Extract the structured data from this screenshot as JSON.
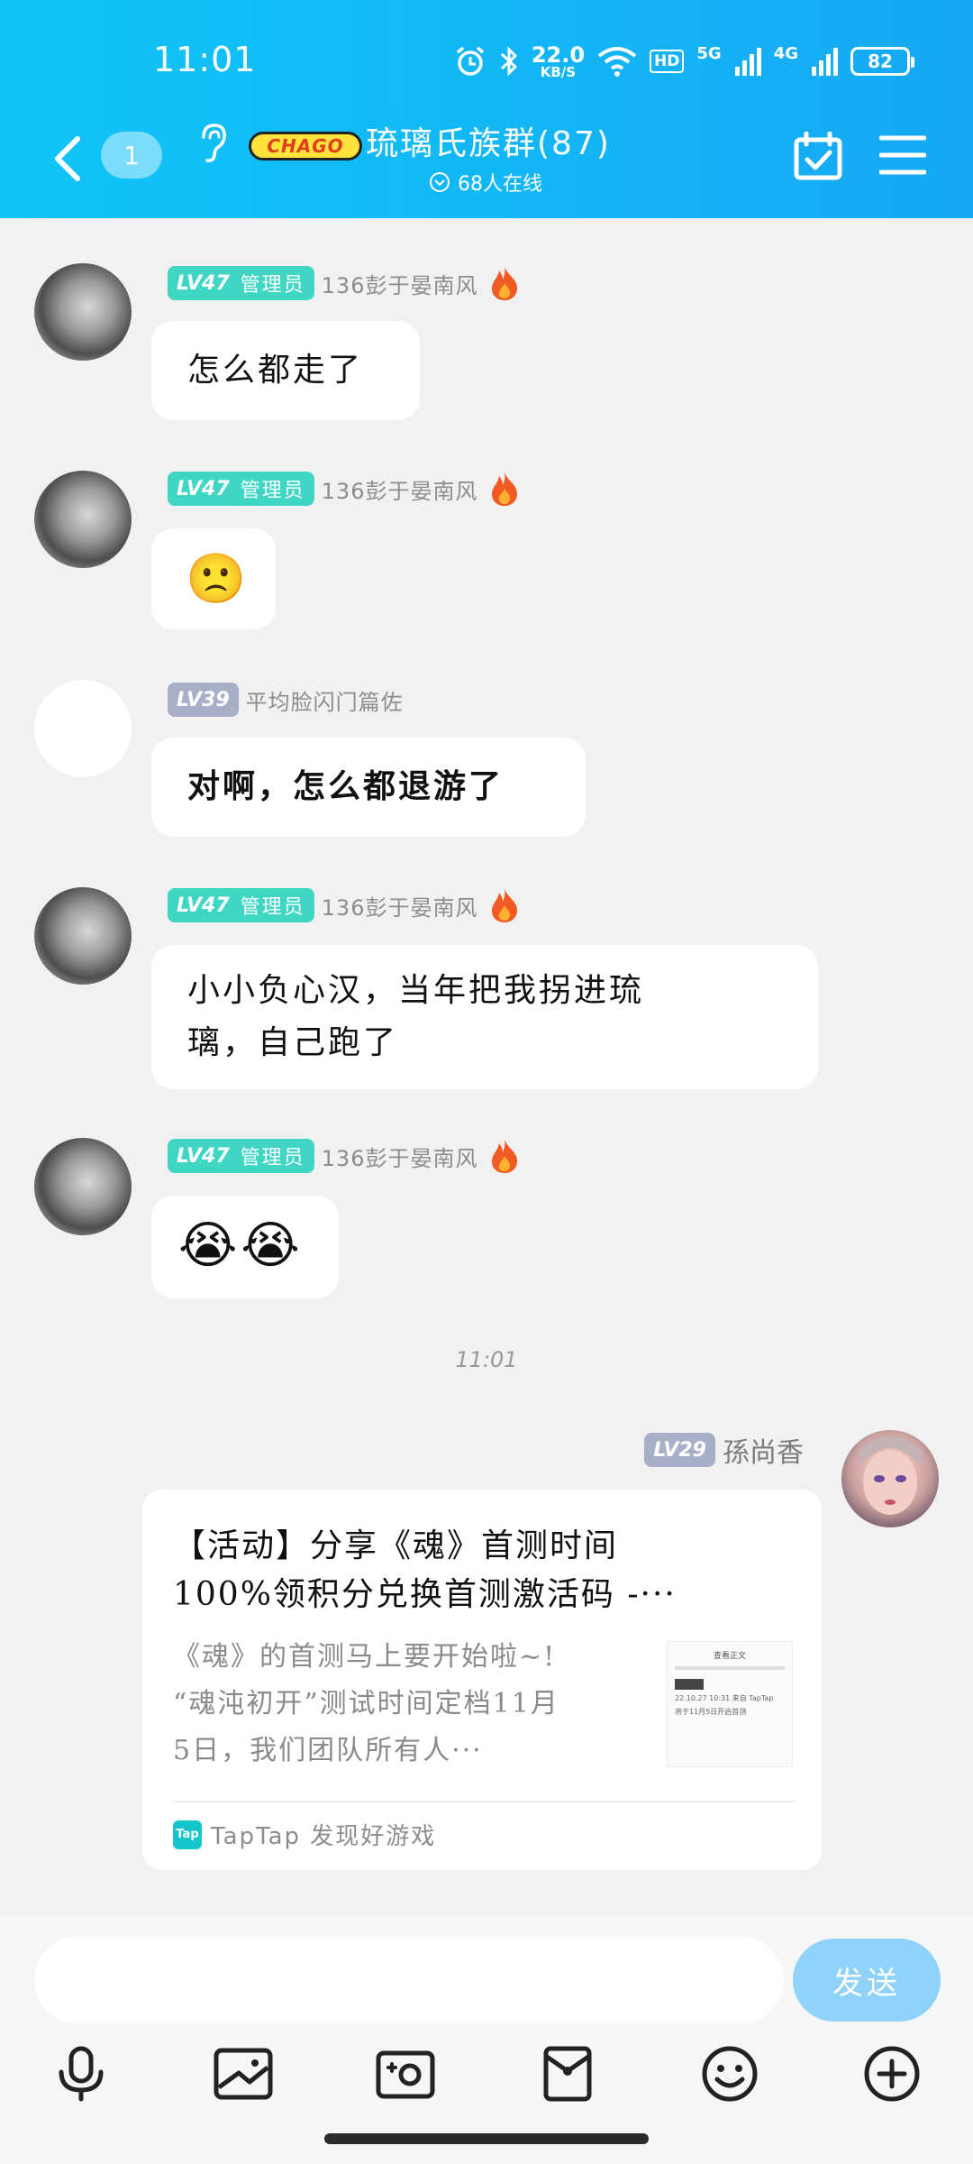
{
  "status_bar": {
    "time": "11:01",
    "net_speed_value": "22.0",
    "net_speed_unit": "KB/S",
    "network_5g": "5G",
    "network_4g": "4G",
    "hd_label": "HD",
    "battery": "82"
  },
  "header": {
    "unread_count": "1",
    "logo_text": "CHAGO",
    "group_name": "琉璃氏族群(87)",
    "online_text": "68人在线"
  },
  "messages": [
    {
      "level": "LV47",
      "role": "管理员",
      "nickname": "136彭于晏南风",
      "text": "怎么都走了"
    },
    {
      "level": "LV47",
      "role": "管理员",
      "nickname": "136彭于晏南风",
      "emoji": "🙁"
    },
    {
      "level": "LV39",
      "role": "",
      "nickname": "平均脸闪门篇佐",
      "text": "对啊，怎么都退游了"
    },
    {
      "level": "LV47",
      "role": "管理员",
      "nickname": "136彭于晏南风",
      "text_line1": "小小负心汉，当年把我拐进琉",
      "text_line2": "璃，自己跑了"
    },
    {
      "level": "LV47",
      "role": "管理员",
      "nickname": "136彭于晏南风",
      "emoji": "😭😭"
    }
  ],
  "time_separator": "11:01",
  "own_message": {
    "level": "LV29",
    "nickname": "孫尚香",
    "card": {
      "title_line1": "【活动】分享《魂》首测时间",
      "title_line2": "100%领积分兑换首测激活码 -···",
      "desc_line1": "《魂》的首测马上要开始啦~!",
      "desc_line2": "“魂沌初开”测试时间定档11月",
      "desc_line3": "5日，我们团队所有人···",
      "thumb_title": "查看正文",
      "thumb_line1": "22.10.27 10:31 来自 TapTap",
      "thumb_line2": "将于11月5日开启首测",
      "source_logo": "Tap",
      "source": "TapTap 发现好游戏"
    }
  },
  "input": {
    "placeholder": "",
    "send_label": "发送"
  },
  "colors": {
    "header": "#12b6f6",
    "admin_badge": "#3fd6c4",
    "grey_badge": "#a7b0c6",
    "send_button": "#8fd2fa"
  },
  "icons": [
    "back-icon",
    "ear-icon",
    "calendar-check-icon",
    "menu-icon",
    "fire-icon",
    "microphone-icon",
    "image-icon",
    "camera-icon",
    "red-packet-icon",
    "emoji-icon",
    "plus-icon"
  ]
}
